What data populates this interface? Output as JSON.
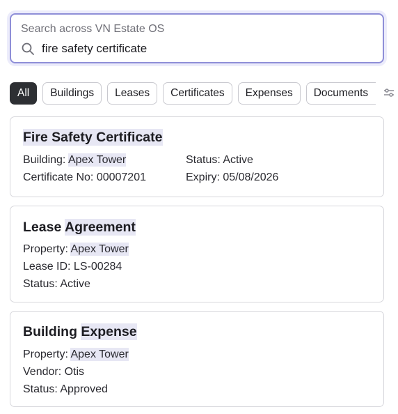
{
  "search": {
    "caption": "Search across VN Estate OS",
    "query": "fire safety certificate"
  },
  "filters": {
    "chips": [
      "All",
      "Buildings",
      "Leases",
      "Certificates",
      "Expenses",
      "Documents"
    ],
    "active": "All"
  },
  "results": [
    {
      "title_parts": [
        "Fire Safety Certificate"
      ],
      "fields": {
        "building_label": "Building: ",
        "building_value": "Apex Tower",
        "certificate_no": "Certificate No: 00007201",
        "status": "Status: Active",
        "expiry": "Expiry: 05/08/2026"
      }
    },
    {
      "title_plain": "Lease ",
      "title_highlight": "Agreement",
      "fields": {
        "property_label": "Property: ",
        "property_value": "Apex Tower",
        "lease_id": "Lease ID: LS-00284",
        "status": "Status: Active"
      }
    },
    {
      "title_plain": "Building ",
      "title_highlight": "Expense",
      "fields": {
        "property_label": "Property: ",
        "property_value": "Apex Tower",
        "vendor": "Vendor: Otis",
        "status": "Status: Approved"
      }
    }
  ]
}
